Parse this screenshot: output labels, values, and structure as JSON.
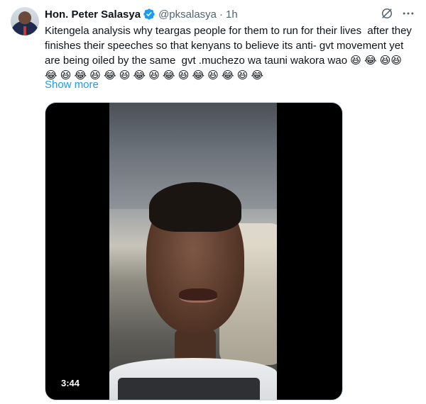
{
  "tweet": {
    "author_name": "Hon. Peter Salasya",
    "handle": "@pksalasya",
    "separator": "·",
    "time": "1h",
    "text": "Kitengela analysis why teargas people for them to run for their lives  after they finishes their speeches so that kenyans to believe its anti- gvt movement yet are being oiled by the same  gvt .muchezo wa tauni wakora wao 😆 😂 😆😆 😂 😆 😂 😆 😂 😆 😂 😆 😂 😆 😂 😆 😂 😆 😂",
    "show_more_label": "Show more",
    "video_duration": "3:44"
  },
  "icons": {
    "verified": "verified-badge-icon",
    "grok": "grok-icon",
    "more": "more-options-icon"
  },
  "colors": {
    "link": "#1d9bf0",
    "secondary_text": "#536471",
    "verified": "#1d9bf0"
  }
}
